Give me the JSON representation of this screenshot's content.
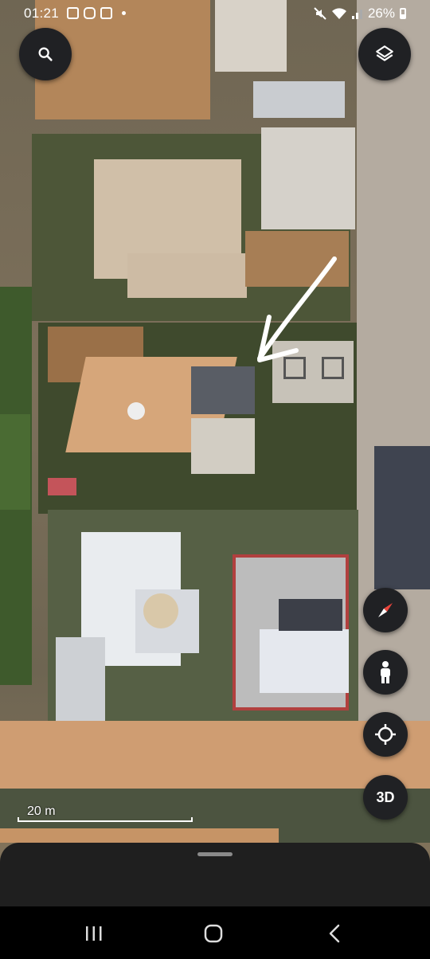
{
  "status_bar": {
    "time": "01:21",
    "battery": "26%",
    "icons": [
      "gallery-icon",
      "instagram-icon",
      "gallery-icon",
      "dot-icon",
      "mute-icon",
      "wifi-icon",
      "signal-icon",
      "battery-icon"
    ]
  },
  "map": {
    "type": "satellite",
    "scale_label": "20 m",
    "annotation": "hand-drawn-white-arrow"
  },
  "controls": {
    "search": "search-icon",
    "layers": "layers-icon",
    "compass": "compass-icon",
    "street_view": "pegman-icon",
    "my_location": "my-location-icon",
    "three_d_label": "3D"
  },
  "colors": {
    "button_bg": "#202124",
    "sheet_bg": "#1f1f1f",
    "compass_red": "#e8453c"
  }
}
